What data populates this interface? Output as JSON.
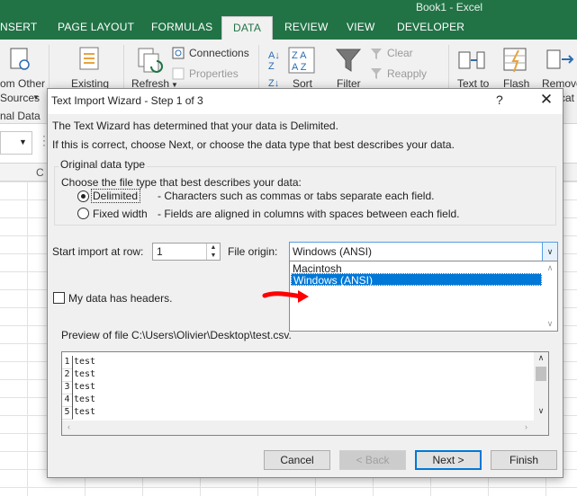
{
  "window": {
    "title": "Book1 - Excel"
  },
  "ribbon_tabs": [
    {
      "label": "NSERT",
      "active": false
    },
    {
      "label": "PAGE LAYOUT",
      "active": false
    },
    {
      "label": "FORMULAS",
      "active": false
    },
    {
      "label": "DATA",
      "active": true
    },
    {
      "label": "REVIEW",
      "active": false
    },
    {
      "label": "VIEW",
      "active": false
    },
    {
      "label": "DEVELOPER",
      "active": false
    }
  ],
  "ribbon": {
    "from_other_1": "om Other",
    "from_other_2": "Sources",
    "external_data_group": "nal Data",
    "existing": "Existing",
    "refresh": "Refresh",
    "connections": "Connections",
    "properties": "Properties",
    "sort": "Sort",
    "filter": "Filter",
    "clear": "Clear",
    "reapply": "Reapply",
    "text_to": "Text to",
    "flash": "Flash",
    "remove": "Remove",
    "remove_2": "cat"
  },
  "sheet": {
    "col_c": "C"
  },
  "dialog": {
    "title": "Text Import Wizard - Step 1 of 3",
    "help": "?",
    "close": "✕",
    "intro_line1": "The Text Wizard has determined that your data is Delimited.",
    "intro_line2": "If this is correct, choose Next, or choose the data type that best describes your data.",
    "group_title": "Original data type",
    "group_prompt": "Choose the file type that best describes your data:",
    "options": [
      {
        "label": "Delimited",
        "description": "- Characters such as commas or tabs separate each field.",
        "selected": true
      },
      {
        "label": "Fixed width",
        "description": "- Fields are aligned in columns with spaces between each field.",
        "selected": false
      }
    ],
    "start_row_label": "Start import at row:",
    "start_row_value": "1",
    "file_origin_label": "File origin:",
    "file_origin_value": "Windows (ANSI)",
    "file_origin_options": [
      "Macintosh",
      "Windows (ANSI)"
    ],
    "file_origin_selected": "Windows (ANSI)",
    "headers_label": "My data has headers.",
    "headers_checked": false,
    "preview_label": "Preview of file C:\\Users\\Olivier\\Desktop\\test.csv.",
    "preview_rows": [
      {
        "num": "1",
        "text": "test"
      },
      {
        "num": "2",
        "text": "test"
      },
      {
        "num": "3",
        "text": "test"
      },
      {
        "num": "4",
        "text": "test"
      },
      {
        "num": "5",
        "text": "test"
      }
    ],
    "buttons": {
      "cancel": "Cancel",
      "back": "< Back",
      "next": "Next >",
      "finish": "Finish"
    }
  },
  "annotation": {
    "arrow_color": "#ff0000"
  },
  "colors": {
    "excel_green": "#217346",
    "selection_blue": "#0078d7"
  }
}
